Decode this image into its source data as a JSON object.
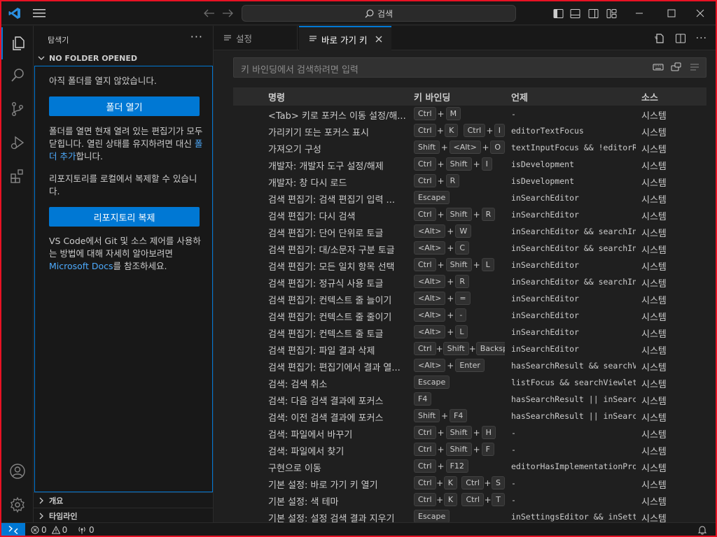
{
  "titlebar": {
    "search_text": "검색"
  },
  "sidebar": {
    "title": "탐색기",
    "more": "···",
    "section_title": "NO FOLDER OPENED",
    "msg1": "아직 폴더를 열지 않았습니다.",
    "open_folder_button": "폴더 열기",
    "msg2_part1": "폴더를 열면 현재 열려 있는 편집기가 모두 닫힙니다. 열린 상태를 유지하려면 대신 ",
    "msg2_link": "폴더 추가",
    "msg2_part2": "합니다.",
    "msg3": "리포지토리를 로컬에서 복제할 수 있습니다.",
    "clone_button": "리포지토리 복제",
    "msg4_part1": "VS Code에서 Git 및 소스 제어를 사용하는 방법에 대해 자세히 알아보려면 ",
    "msg4_link": "Microsoft Docs",
    "msg4_part2": "를 참조하세요.",
    "outline": "개요",
    "timeline": "타임라인"
  },
  "tabs": [
    {
      "label": "설정",
      "active": false
    },
    {
      "label": "바로 가기 키",
      "active": true
    }
  ],
  "keybindings": {
    "search_placeholder": "키 바인딩에서 검색하려면 입력",
    "headers": {
      "command": "명령",
      "keybinding": "키 바인딩",
      "when": "언제",
      "source": "소스"
    },
    "rows": [
      {
        "command": "<Tab> 키로 포커스 이동 설정/해...",
        "keys": [
          [
            "Ctrl",
            "M"
          ]
        ],
        "when": "-",
        "source": "시스템"
      },
      {
        "command": "가리키기 또는 포커스 표시",
        "keys": [
          [
            "Ctrl",
            "K"
          ],
          [
            "Ctrl",
            "I"
          ]
        ],
        "when": "editorTextFocus",
        "source": "시스템"
      },
      {
        "command": "가져오기 구성",
        "keys": [
          [
            "Shift",
            "<Alt>",
            "O"
          ]
        ],
        "when": "textInputFocus && !editorR…",
        "source": "시스템"
      },
      {
        "command": "개발자: 개발자 도구 설정/해제",
        "keys": [
          [
            "Ctrl",
            "Shift",
            "I"
          ]
        ],
        "when": "isDevelopment",
        "source": "시스템"
      },
      {
        "command": "개발자: 창 다시 로드",
        "keys": [
          [
            "Ctrl",
            "R"
          ]
        ],
        "when": "isDevelopment",
        "source": "시스템"
      },
      {
        "command": "검색 편집기: 검색 편집기 입력 ...",
        "keys": [
          [
            "Escape"
          ]
        ],
        "when": "inSearchEditor",
        "source": "시스템"
      },
      {
        "command": "검색 편집기: 다시 검색",
        "keys": [
          [
            "Ctrl",
            "Shift",
            "R"
          ]
        ],
        "when": "inSearchEditor",
        "source": "시스템"
      },
      {
        "command": "검색 편집기: 단어 단위로 토글",
        "keys": [
          [
            "<Alt>",
            "W"
          ]
        ],
        "when": "inSearchEditor && searchIn…",
        "source": "시스템"
      },
      {
        "command": "검색 편집기: 대/소문자 구분 토글",
        "keys": [
          [
            "<Alt>",
            "C"
          ]
        ],
        "when": "inSearchEditor && searchIn…",
        "source": "시스템"
      },
      {
        "command": "검색 편집기: 모든 일치 항목 선택",
        "keys": [
          [
            "Ctrl",
            "Shift",
            "L"
          ]
        ],
        "when": "inSearchEditor",
        "source": "시스템"
      },
      {
        "command": "검색 편집기: 정규식 사용 토글",
        "keys": [
          [
            "<Alt>",
            "R"
          ]
        ],
        "when": "inSearchEditor && searchIn…",
        "source": "시스템"
      },
      {
        "command": "검색 편집기: 컨텍스트 줄 늘이기",
        "keys": [
          [
            "<Alt>",
            "="
          ]
        ],
        "when": "inSearchEditor",
        "source": "시스템"
      },
      {
        "command": "검색 편집기: 컨텍스트 줄 줄이기",
        "keys": [
          [
            "<Alt>",
            "-"
          ]
        ],
        "when": "inSearchEditor",
        "source": "시스템"
      },
      {
        "command": "검색 편집기: 컨텍스트 줄 토글",
        "keys": [
          [
            "<Alt>",
            "L"
          ]
        ],
        "when": "inSearchEditor",
        "source": "시스템"
      },
      {
        "command": "검색 편집기: 파일 결과 삭제",
        "keys": [
          [
            "Ctrl",
            "Shift",
            "Backsp"
          ]
        ],
        "when": "inSearchEditor",
        "source": "시스템"
      },
      {
        "command": "검색 편집기: 편집기에서 결과 열...",
        "keys": [
          [
            "<Alt>",
            "Enter"
          ]
        ],
        "when": "hasSearchResult && searchV…",
        "source": "시스템"
      },
      {
        "command": "검색: 검색 취소",
        "keys": [
          [
            "Escape"
          ]
        ],
        "when": "listFocus && searchViewlet…",
        "source": "시스템"
      },
      {
        "command": "검색: 다음 검색 결과에 포커스",
        "keys": [
          [
            "F4"
          ]
        ],
        "when": "hasSearchResult || inSearc…",
        "source": "시스템"
      },
      {
        "command": "검색: 이전 검색 결과에 포커스",
        "keys": [
          [
            "Shift",
            "F4"
          ]
        ],
        "when": "hasSearchResult || inSearc…",
        "source": "시스템"
      },
      {
        "command": "검색: 파일에서 바꾸기",
        "keys": [
          [
            "Ctrl",
            "Shift",
            "H"
          ]
        ],
        "when": "-",
        "source": "시스템"
      },
      {
        "command": "검색: 파일에서 찾기",
        "keys": [
          [
            "Ctrl",
            "Shift",
            "F"
          ]
        ],
        "when": "-",
        "source": "시스템"
      },
      {
        "command": "구현으로 이동",
        "keys": [
          [
            "Ctrl",
            "F12"
          ]
        ],
        "when": "editorHasImplementationPro…",
        "source": "시스템"
      },
      {
        "command": "기본 설정: 바로 가기 키 열기",
        "keys": [
          [
            "Ctrl",
            "K"
          ],
          [
            "Ctrl",
            "S"
          ]
        ],
        "when": "-",
        "source": "시스템"
      },
      {
        "command": "기본 설정: 색 테마",
        "keys": [
          [
            "Ctrl",
            "K"
          ],
          [
            "Ctrl",
            "T"
          ]
        ],
        "when": "-",
        "source": "시스템"
      },
      {
        "command": "기본 설정: 설정 검색 결과 지우기",
        "keys": [
          [
            "Escape"
          ]
        ],
        "when": "inSettingsEditor && inSett…",
        "source": "시스템"
      }
    ]
  },
  "statusbar": {
    "errors": "0",
    "warnings": "0",
    "ports": "0"
  },
  "colors": {
    "accent": "#0078d4",
    "window_border": "#e81123",
    "link": "#4daafc"
  }
}
